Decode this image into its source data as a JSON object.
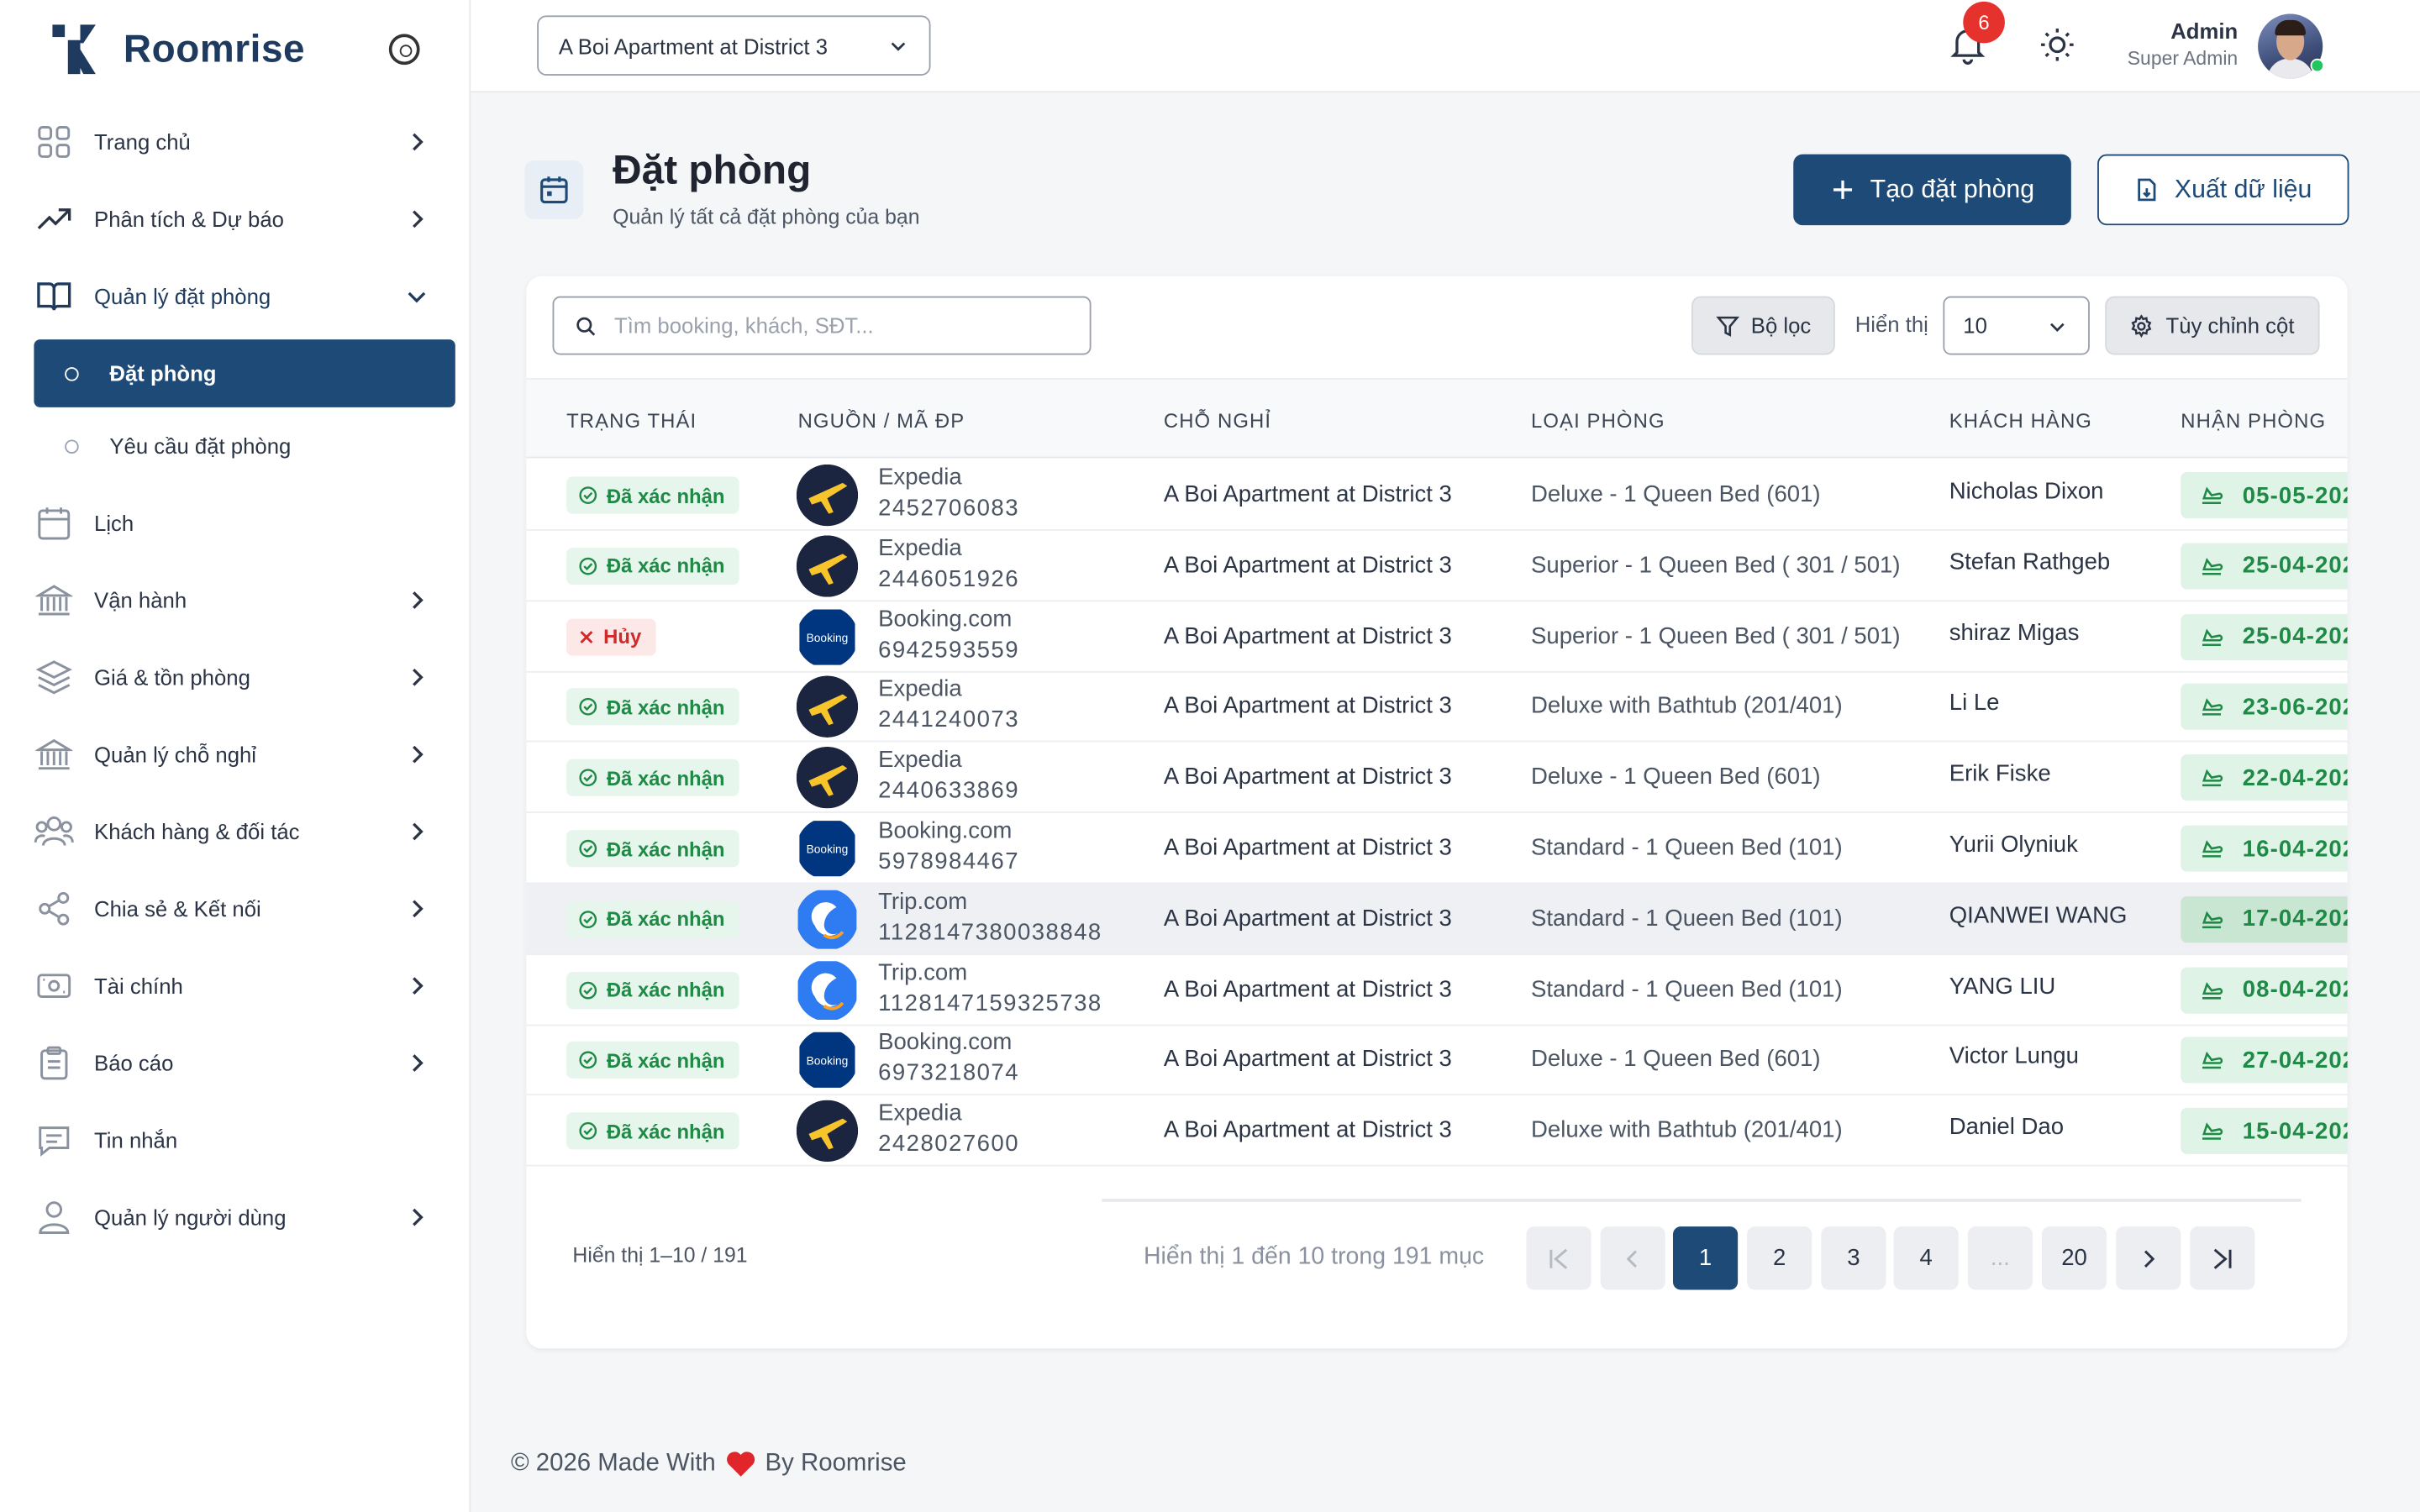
{
  "app": {
    "name": "Roomrise"
  },
  "sidebar": {
    "items": [
      {
        "label": "Trang chủ"
      },
      {
        "label": "Phân tích & Dự báo"
      },
      {
        "label": "Quản lý đặt phòng"
      },
      {
        "label": "Đặt phòng"
      },
      {
        "label": "Yêu cầu đặt phòng"
      },
      {
        "label": "Lịch"
      },
      {
        "label": "Vận hành"
      },
      {
        "label": "Giá & tồn phòng"
      },
      {
        "label": "Quản lý chỗ nghỉ"
      },
      {
        "label": "Khách hàng & đối tác"
      },
      {
        "label": "Chia sẻ & Kết nối"
      },
      {
        "label": "Tài chính"
      },
      {
        "label": "Báo cáo"
      },
      {
        "label": "Tin nhắn"
      },
      {
        "label": "Quản lý người dùng"
      }
    ]
  },
  "topbar": {
    "property": "A Boi Apartment at District 3",
    "notifications": "6",
    "user_name": "Admin",
    "user_role": "Super Admin"
  },
  "header": {
    "title": "Đặt phòng",
    "subtitle": "Quản lý tất cả đặt phòng của bạn",
    "create_label": "Tạo đặt phòng",
    "export_label": "Xuất dữ liệu"
  },
  "toolbar": {
    "search_placeholder": "Tìm booking, khách, SĐT...",
    "filter_label": "Bộ lọc",
    "show_label": "Hiển thị",
    "page_size": "10",
    "columns_label": "Tùy chỉnh cột"
  },
  "table": {
    "columns": [
      "TRẠNG THÁI",
      "NGUỒN / MÃ ĐP",
      "CHỖ NGHỈ",
      "LOẠI PHÒNG",
      "KHÁCH HÀNG",
      "NHẬN PHÒNG"
    ],
    "rows": [
      {
        "status": "Đã xác nhận",
        "status_type": "confirmed",
        "source": "Expedia",
        "source_logo": "expedia",
        "code": "2452706083",
        "property": "A Boi Apartment at District 3",
        "room": "Deluxe - 1 Queen Bed (601)",
        "guest": "Nicholas Dixon",
        "checkin": "05-05-202"
      },
      {
        "status": "Đã xác nhận",
        "status_type": "confirmed",
        "source": "Expedia",
        "source_logo": "expedia",
        "code": "2446051926",
        "property": "A Boi Apartment at District 3",
        "room": "Superior - 1 Queen Bed ( 301 / 501)",
        "guest": "Stefan Rathgeb",
        "checkin": "25-04-202"
      },
      {
        "status": "Hủy",
        "status_type": "cancelled",
        "source": "Booking.com",
        "source_logo": "booking",
        "code": "6942593559",
        "property": "A Boi Apartment at District 3",
        "room": "Superior - 1 Queen Bed ( 301 / 501)",
        "guest": "shiraz Migas",
        "checkin": "25-04-202"
      },
      {
        "status": "Đã xác nhận",
        "status_type": "confirmed",
        "source": "Expedia",
        "source_logo": "expedia",
        "code": "2441240073",
        "property": "A Boi Apartment at District 3",
        "room": "Deluxe with Bathtub (201/401)",
        "guest": "Li Le",
        "checkin": "23-06-202"
      },
      {
        "status": "Đã xác nhận",
        "status_type": "confirmed",
        "source": "Expedia",
        "source_logo": "expedia",
        "code": "2440633869",
        "property": "A Boi Apartment at District 3",
        "room": "Deluxe - 1 Queen Bed (601)",
        "guest": "Erik Fiske",
        "checkin": "22-04-202"
      },
      {
        "status": "Đã xác nhận",
        "status_type": "confirmed",
        "source": "Booking.com",
        "source_logo": "booking",
        "code": "5978984467",
        "property": "A Boi Apartment at District 3",
        "room": "Standard - 1 Queen Bed (101)",
        "guest": "Yurii Olyniuk",
        "checkin": "16-04-202"
      },
      {
        "status": "Đã xác nhận",
        "status_type": "confirmed",
        "source": "Trip.com",
        "source_logo": "trip",
        "code": "1128147380038848",
        "property": "A Boi Apartment at District 3",
        "room": "Standard - 1 Queen Bed (101)",
        "guest": "QIANWEI WANG",
        "checkin": "17-04-202"
      },
      {
        "status": "Đã xác nhận",
        "status_type": "confirmed",
        "source": "Trip.com",
        "source_logo": "trip",
        "code": "1128147159325738",
        "property": "A Boi Apartment at District 3",
        "room": "Standard - 1 Queen Bed (101)",
        "guest": "YANG LIU",
        "checkin": "08-04-202"
      },
      {
        "status": "Đã xác nhận",
        "status_type": "confirmed",
        "source": "Booking.com",
        "source_logo": "booking",
        "code": "6973218074",
        "property": "A Boi Apartment at District 3",
        "room": "Deluxe - 1 Queen Bed (601)",
        "guest": "Victor Lungu",
        "checkin": "27-04-202"
      },
      {
        "status": "Đã xác nhận",
        "status_type": "confirmed",
        "source": "Expedia",
        "source_logo": "expedia",
        "code": "2428027600",
        "property": "A Boi Apartment at District 3",
        "room": "Deluxe with Bathtub (201/401)",
        "guest": "Daniel Dao",
        "checkin": "15-04-202"
      }
    ]
  },
  "pagination": {
    "summary_left": "Hiển thị 1–10 / 191",
    "summary_mid": "Hiển thị 1 đến 10 trong 191 mục",
    "pages": [
      "1",
      "2",
      "3",
      "4",
      "...",
      "20"
    ],
    "current": "1"
  },
  "footer": {
    "prefix": "© 2026 Made With",
    "suffix": "By Roomrise"
  },
  "colors": {
    "primary": "#1e4a78",
    "success": "#1e8a45",
    "danger": "#d12a2a"
  }
}
